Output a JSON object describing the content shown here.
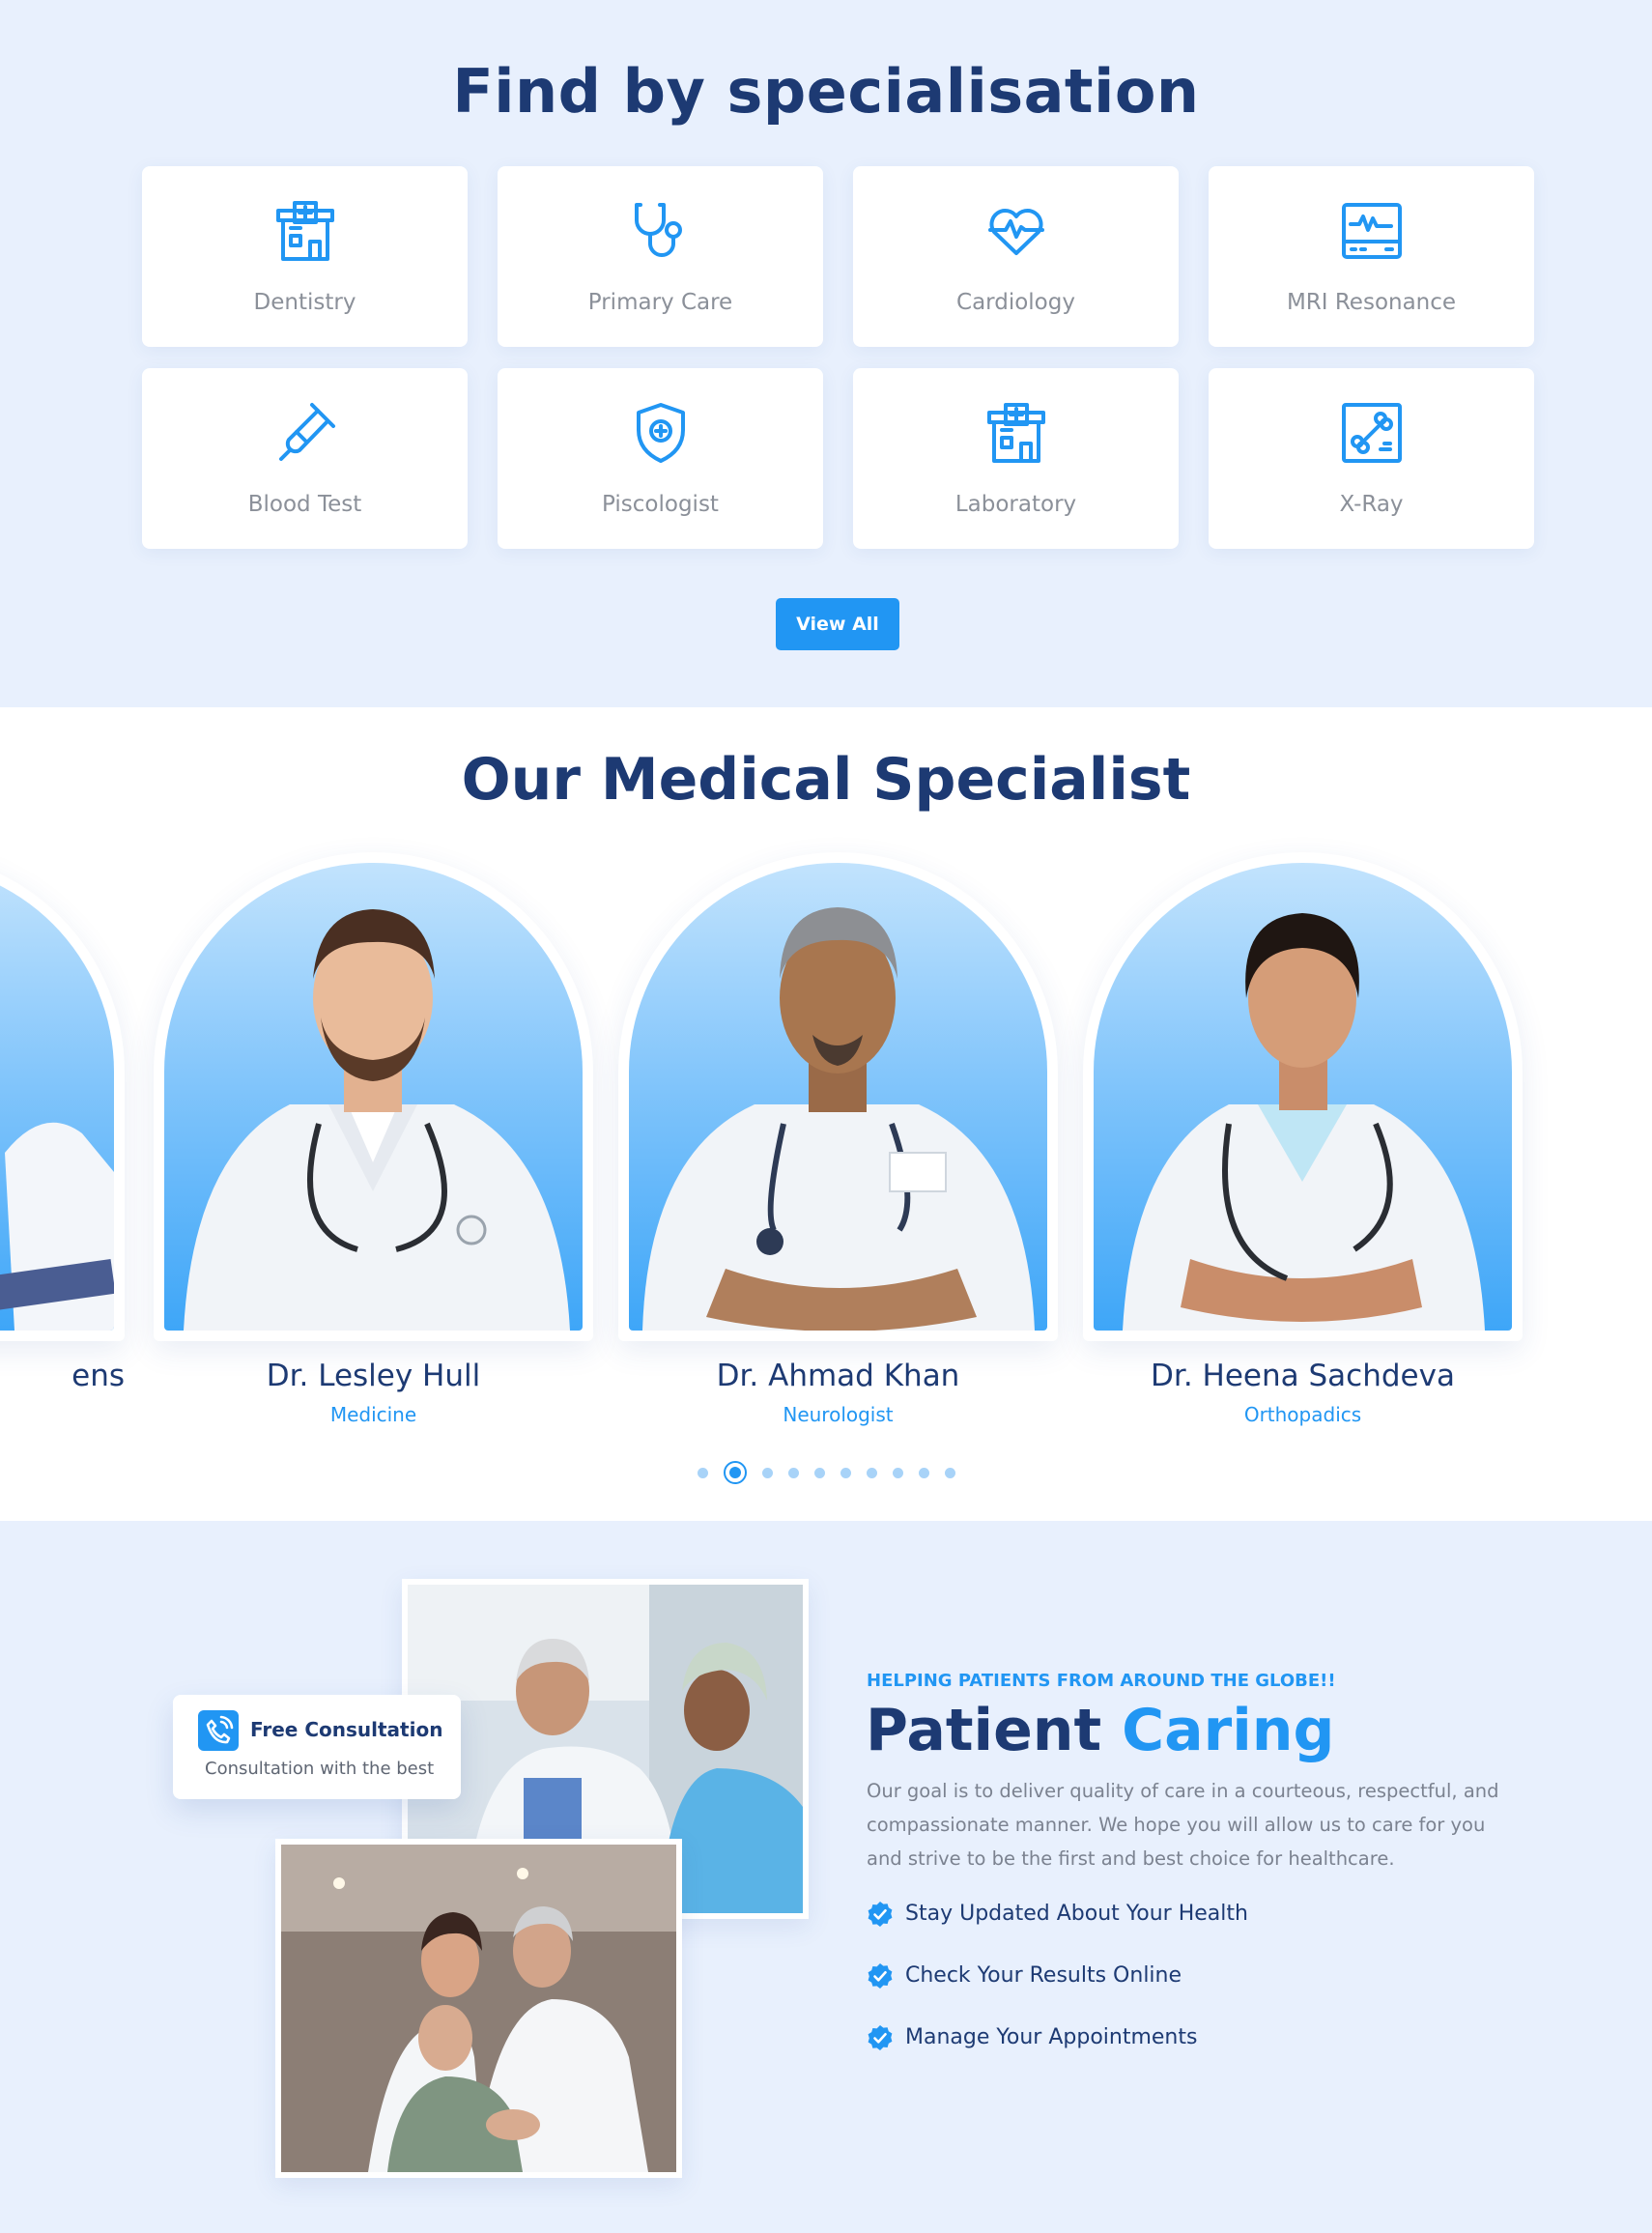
{
  "specialisation": {
    "title": "Find by specialisation",
    "items": [
      {
        "label": "Dentistry",
        "icon": "hospital-building-icon"
      },
      {
        "label": "Primary Care",
        "icon": "stethoscope-icon"
      },
      {
        "label": "Cardiology",
        "icon": "heart-pulse-icon"
      },
      {
        "label": "MRI Resonance",
        "icon": "monitor-pulse-icon"
      },
      {
        "label": "Blood Test",
        "icon": "test-tube-icon"
      },
      {
        "label": "Piscologist",
        "icon": "medical-shield-icon"
      },
      {
        "label": "Laboratory",
        "icon": "hospital-building-icon"
      },
      {
        "label": "X-Ray",
        "icon": "bone-xray-icon"
      }
    ],
    "view_all_label": "View All"
  },
  "specialists": {
    "title": "Our Medical Specialist",
    "doctors": [
      {
        "name": "ens",
        "role": ""
      },
      {
        "name": "Dr. Lesley Hull",
        "role": "Medicine"
      },
      {
        "name": "Dr. Ahmad Khan",
        "role": "Neurologist"
      },
      {
        "name": "Dr. Heena Sachdeva",
        "role": "Orthopadics"
      }
    ],
    "pagination": {
      "total_pages": 10,
      "active_page": 2
    }
  },
  "care": {
    "eyebrow": "HELPING PATIENTS FROM AROUND THE GLOBE!!",
    "title_main": "Patient",
    "title_accent": "Caring",
    "description": "Our goal is to deliver quality of care in a courteous, respectful, and compassionate manner. We hope you will allow us to care for you and strive to be the first and best choice for healthcare.",
    "checklist": [
      "Stay Updated About Your Health",
      "Check Your Results Online",
      "Manage Your Appointments"
    ],
    "consultation": {
      "title": "Free Consultation",
      "subtitle": "Consultation with the best",
      "icon": "phone-icon"
    }
  },
  "colors": {
    "primary": "#2196f3",
    "navy": "#1d3a73",
    "section_bg": "#e8f0fd",
    "muted_text": "#8b9099"
  }
}
